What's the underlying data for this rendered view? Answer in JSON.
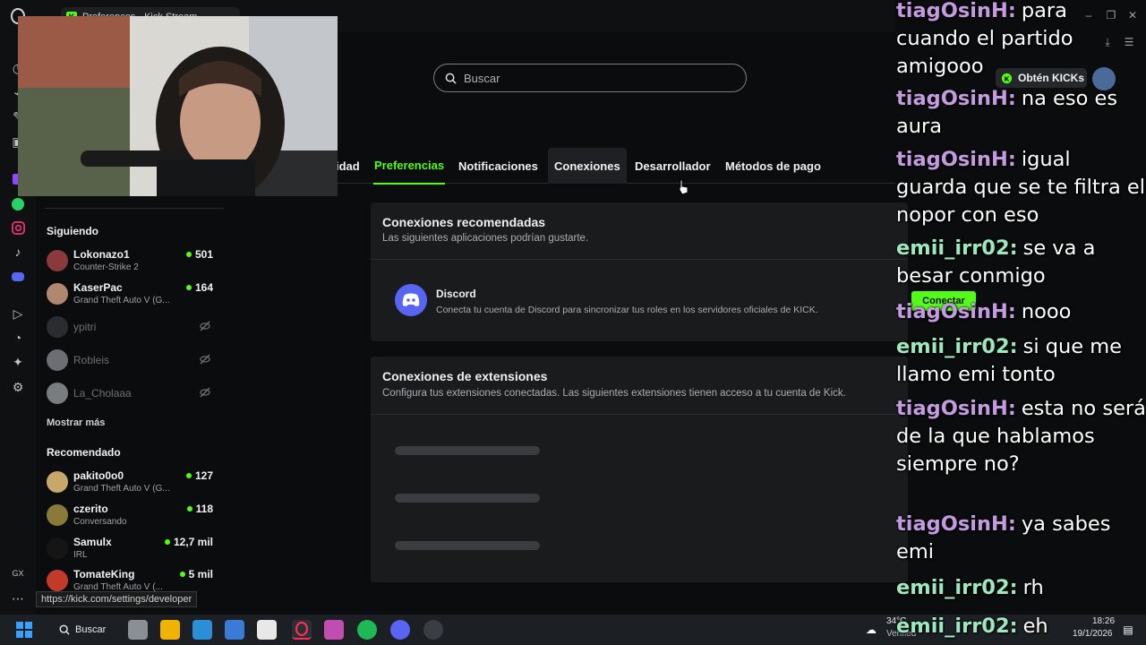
{
  "browser": {
    "tab_title": "Preferences - Kick Stream",
    "opera_label": "GX"
  },
  "search": {
    "placeholder": "Buscar"
  },
  "settings_tabs": [
    {
      "label": "idad"
    },
    {
      "label": "Preferencias"
    },
    {
      "label": "Notificaciones"
    },
    {
      "label": "Conexiones"
    },
    {
      "label": "Desarrollador"
    },
    {
      "label": "Métodos de pago"
    }
  ],
  "sidebar": {
    "following_title": "Siguiendo",
    "following": [
      {
        "name": "Lokonazo1",
        "game": "Counter-Strike 2",
        "viewers": "501"
      },
      {
        "name": "KaserPac",
        "game": "Grand Theft Auto V (G...",
        "viewers": "164"
      },
      {
        "name": "ypitri"
      },
      {
        "name": "Robleis"
      },
      {
        "name": "La_Cholaaa"
      }
    ],
    "show_more": "Mostrar más",
    "recommended_title": "Recomendado",
    "recommended": [
      {
        "name": "pakito0o0",
        "game": "Grand Theft Auto V (G...",
        "viewers": "127"
      },
      {
        "name": "czerito",
        "game": "Conversando",
        "viewers": "118"
      },
      {
        "name": "Samulx",
        "game": "IRL",
        "viewers": "12,7 mil"
      },
      {
        "name": "TomateKing",
        "game": "Grand Theft Auto V (...",
        "viewers": "5 mil"
      }
    ]
  },
  "cards": {
    "recommended": {
      "title": "Conexiones recomendadas",
      "subtitle": "Las siguientes aplicaciones podrían gustarte.",
      "app_name": "Discord",
      "app_desc": "Conecta tu cuenta de Discord para sincronizar tus roles en los servidores oficiales de KICK.",
      "connect_label": "Conectar"
    },
    "extensions": {
      "title": "Conexiones de extensiones",
      "subtitle": "Configura tus extensiones conectadas. Las siguientes extensiones tienen acceso a tu cuenta de Kick."
    }
  },
  "header": {
    "kicks_label": "Obtén KICKs"
  },
  "chat": [
    {
      "user": "tiagOsinH:",
      "text": "para cuando el partido amigooo",
      "color": "#c49be0"
    },
    {
      "user": "tiagOsinH:",
      "text": "na eso es aura",
      "color": "#c49be0"
    },
    {
      "user": "tiagOsinH:",
      "text": "igual guarda que se te filtra el nopor con eso",
      "color": "#c49be0"
    },
    {
      "user": "emii_irr02:",
      "text": "se va a besar conmigo",
      "color": "#9ee8c0"
    },
    {
      "user": "tiagOsinH:",
      "text": "nooo",
      "color": "#c49be0"
    },
    {
      "user": "emii_irr02:",
      "text": "si que me llamo emi tonto",
      "color": "#9ee8c0"
    },
    {
      "user": "tiagOsinH:",
      "text": "esta no será de la que hablamos siempre no?",
      "color": "#c49be0"
    },
    {
      "user": "tiagOsinH:",
      "text": "ya sabes emi",
      "color": "#c49be0"
    },
    {
      "user": "emii_irr02:",
      "text": "rh",
      "color": "#9ee8c0"
    },
    {
      "user": "emii_irr02:",
      "text": "eh",
      "color": "#9ee8c0"
    }
  ],
  "status_url": "https://kick.com/settings/developer",
  "taskbar": {
    "search_label": "Buscar",
    "temperature": "34°C",
    "weather": "Verified",
    "time": "18:26",
    "date": "19/1/2026"
  },
  "colors": {
    "kick_green": "#53fc18",
    "background": "#0b0c0d",
    "card": "#191b1d",
    "discord": "#5865f2"
  }
}
